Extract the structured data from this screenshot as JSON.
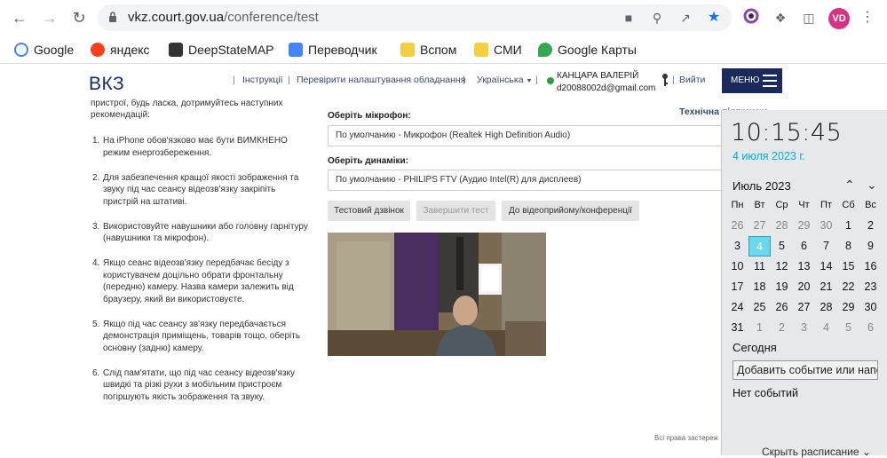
{
  "browser": {
    "url_host": "vkz.court.gov.ua",
    "url_path": "/conference/test",
    "avatar_initials": "VD"
  },
  "bookmarks": [
    {
      "label": "Google",
      "icon": "google-icon",
      "color": "#4285f4"
    },
    {
      "label": "яндекс",
      "icon": "yandex-icon",
      "color": "#fc3f1d"
    },
    {
      "label": "DeepStateMAP",
      "icon": "deepstate-icon",
      "color": "#333333"
    },
    {
      "label": "Переводчик",
      "icon": "translate-icon",
      "color": "#4285f4"
    },
    {
      "label": "Вспом",
      "icon": "folder-icon",
      "color": "#f4d03f"
    },
    {
      "label": "СМИ",
      "icon": "folder-icon",
      "color": "#f4d03f"
    },
    {
      "label": "Google Карты",
      "icon": "maps-icon",
      "color": "#34a853"
    }
  ],
  "site": {
    "brand": "ВКЗ",
    "nav_instructions": "Інструкції",
    "nav_check": "Перевірити налаштування обладнання",
    "nav_lang": "Українська",
    "user_name": "КАНЦАРА ВАЛЕРІЙ",
    "user_email": "d20088002d@gmail.com",
    "logout": "Вийти",
    "menu": "МЕНЮ",
    "tech_support": "Технічна підтримка"
  },
  "intro": "пристрої, будь ласка, дотримуйтесь наступних рекомендацій:",
  "recommendations": [
    {
      "num": "1.",
      "text": "На iPhone обов'язково має бути ВИМКНЕНО режим енергозбереження."
    },
    {
      "num": "2.",
      "text": "Для забезпечення кращої якості зображення та звуку під час сеансу відеозв'язку закріпіть пристрій на штативі."
    },
    {
      "num": "3.",
      "text": "Використовуйте навушники або головну гарнітуру (навушники та мікрофон)."
    },
    {
      "num": "4.",
      "text": "Якщо сеанс відеозв'язку передбачає бесіду з користувачем доцільно обрати фронтальну (передню) камеру. Назва камери залежить від браузеру, який ви використовуєте."
    },
    {
      "num": "5.",
      "text": "Якщо під час сеансу зв'язку передбачається демонстрація приміщень, товарів тощо, оберіть основну (задню) камеру."
    },
    {
      "num": "6.",
      "text": "Слід пам'ятати, що під час сеансу відеозв'язку швидкі та різкі рухи з мобільним пристроєм погіршують якість зображення та звуку."
    }
  ],
  "devices": {
    "mic_label": "Оберіть мікрофон:",
    "mic_value": "По умолчанию - Микрофон (Realtek High Definition Audio)",
    "speaker_label": "Оберіть динаміки:",
    "speaker_value": "По умолчанию - PHILIPS FTV (Аудио Intel(R) для дисплеев)"
  },
  "buttons": {
    "test_call": "Тестовий дзвінок",
    "finish_test": "Завершити тест",
    "to_conference": "До відеоприйому/конференції"
  },
  "footer": "Всі права застереж",
  "clock": {
    "time": "10:15:45",
    "date": "4 июля 2023 г.",
    "month": "Июль 2023",
    "weekdays": [
      "Пн",
      "Вт",
      "Ср",
      "Чт",
      "Пт",
      "Сб",
      "Вс"
    ],
    "weeks": [
      [
        "26",
        "27",
        "28",
        "29",
        "30",
        "1",
        "2"
      ],
      [
        "3",
        "4",
        "5",
        "6",
        "7",
        "8",
        "9"
      ],
      [
        "10",
        "11",
        "12",
        "13",
        "14",
        "15",
        "16"
      ],
      [
        "17",
        "18",
        "19",
        "20",
        "21",
        "22",
        "23"
      ],
      [
        "24",
        "25",
        "26",
        "27",
        "28",
        "29",
        "30"
      ],
      [
        "31",
        "1",
        "2",
        "3",
        "4",
        "5",
        "6"
      ]
    ],
    "today_day": "4",
    "today": "Сегодня",
    "add_event_placeholder": "Добавить событие или напоминание",
    "no_events": "Нет событий",
    "hide_schedule": "Скрыть расписание"
  }
}
